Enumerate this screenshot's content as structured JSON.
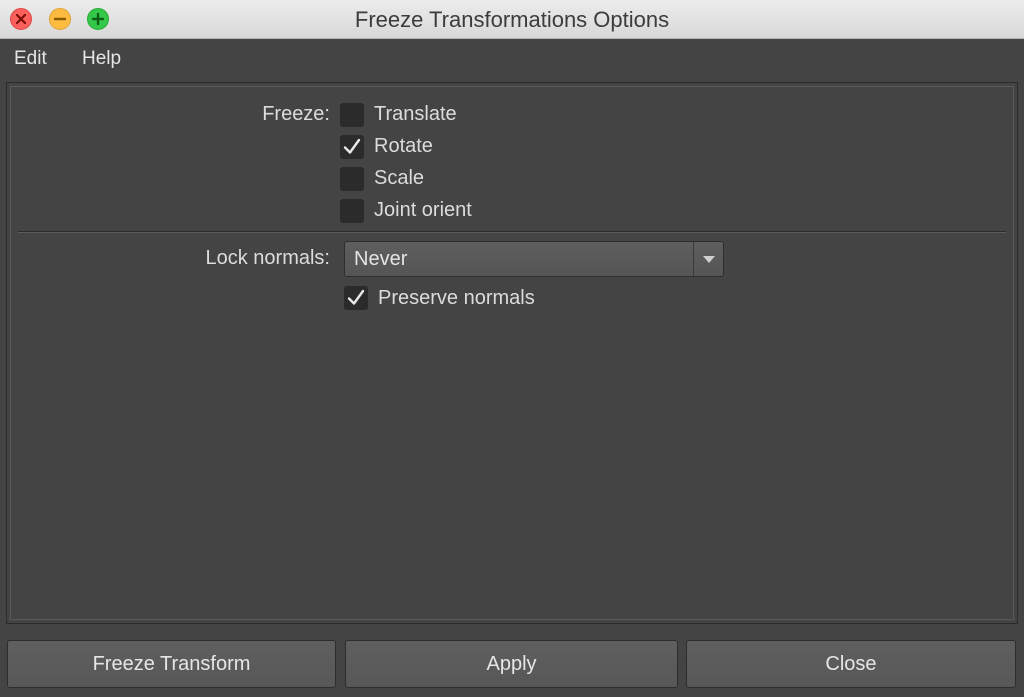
{
  "window": {
    "title": "Freeze Transformations Options"
  },
  "menubar": {
    "items": [
      {
        "label": "Edit"
      },
      {
        "label": "Help"
      }
    ]
  },
  "freeze": {
    "label": "Freeze:",
    "options": [
      {
        "label": "Translate",
        "checked": false
      },
      {
        "label": "Rotate",
        "checked": true
      },
      {
        "label": "Scale",
        "checked": false
      },
      {
        "label": "Joint orient",
        "checked": false
      }
    ]
  },
  "lock_normals": {
    "label": "Lock normals:",
    "selected": "Never"
  },
  "preserve_normals": {
    "label": "Preserve normals",
    "checked": true
  },
  "buttons": {
    "freeze": "Freeze Transform",
    "apply": "Apply",
    "close": "Close"
  },
  "icons": {
    "close": "close-icon",
    "minimize": "minimize-icon",
    "maximize": "maximize-icon",
    "checkmark": "checkmark-icon",
    "dropdown_arrow": "chevron-down-icon"
  },
  "colors": {
    "background": "#444444",
    "checkbox": "#2b2b2b",
    "text": "#dcdcdc",
    "close": "#fc605c",
    "minimize": "#fdbc40",
    "maximize": "#34c84a"
  }
}
